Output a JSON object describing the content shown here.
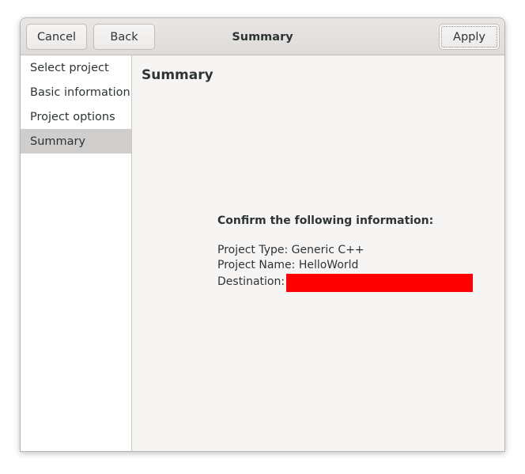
{
  "headerbar": {
    "title": "Summary",
    "cancel_label": "Cancel",
    "back_label": "Back",
    "apply_label": "Apply"
  },
  "sidebar": {
    "items": [
      {
        "label": "Select project"
      },
      {
        "label": "Basic information"
      },
      {
        "label": "Project options"
      },
      {
        "label": "Summary",
        "selected": true
      }
    ]
  },
  "main": {
    "title": "Summary",
    "confirm_heading": "Confirm the following information:",
    "project_type": "Project Type: Generic C++",
    "project_name": "Project Name: HelloWorld",
    "destination_label": "Destination:"
  },
  "colors": {
    "redaction": "#ff0000",
    "selected_row": "#cfcecd"
  }
}
